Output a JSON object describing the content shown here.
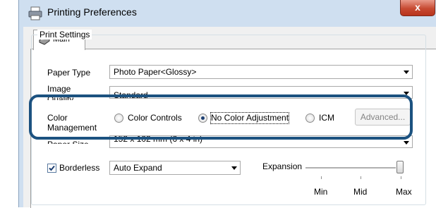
{
  "window": {
    "title": "Printing Preferences",
    "close_glyph": "x"
  },
  "tabs": [
    {
      "label": "Main",
      "icon": "printer-icon"
    }
  ],
  "print_settings": {
    "group_title": "Print Settings",
    "paper_type": {
      "label": "Paper Type",
      "value": "Photo Paper<Glossy>"
    },
    "quality": {
      "label": "Image Quality",
      "label_line1": "Image",
      "label_line2": "Quality",
      "value": "Standard"
    },
    "color_management": {
      "label_line1": "Color",
      "label_line2": "Management",
      "options": [
        "Color Controls",
        "No Color Adjustment",
        "ICM"
      ],
      "selected": "No Color Adjustment",
      "advanced_label": "Advanced..."
    },
    "paper_size": {
      "label": "Paper Size",
      "value": "152 x 102 mm (6 x 4 in)"
    },
    "borderless": {
      "label": "Borderless",
      "checked": true,
      "value": "Auto Expand"
    },
    "expansion": {
      "label": "Expansion",
      "ticks": [
        "Min",
        "Mid",
        "Max"
      ],
      "level": "Max"
    }
  },
  "colors": {
    "highlight": "#1c5280",
    "window_frame": "#cfdff0",
    "close_button": "#c74a32"
  }
}
